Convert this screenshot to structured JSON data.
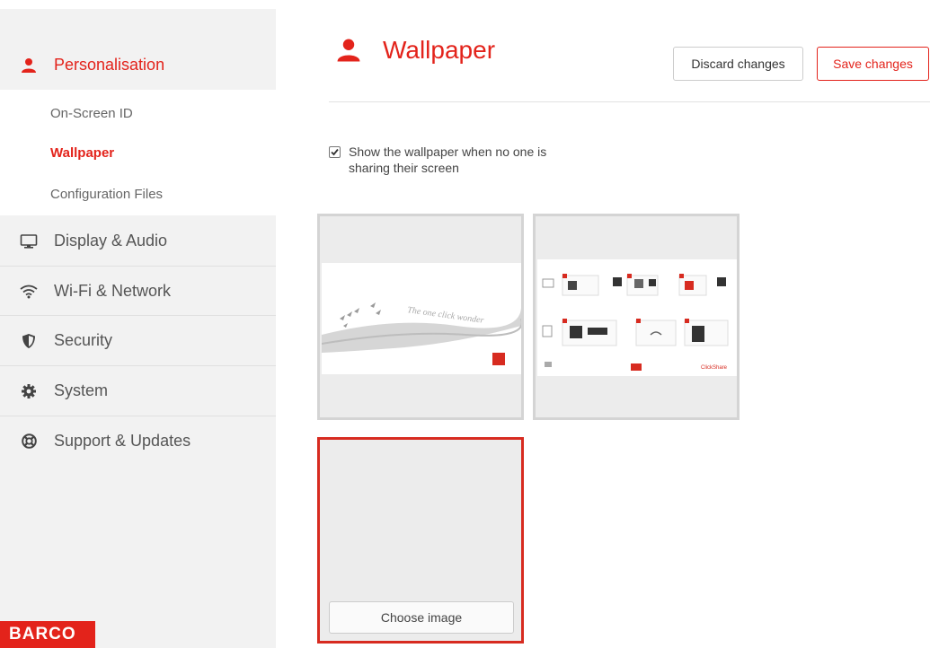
{
  "sidebar": {
    "section_title": "Personalisation",
    "sub_items": [
      {
        "label": "On-Screen ID"
      },
      {
        "label": "Wallpaper"
      },
      {
        "label": "Configuration Files"
      }
    ],
    "items": [
      {
        "label": "Display & Audio",
        "icon": "monitor-icon"
      },
      {
        "label": "Wi-Fi & Network",
        "icon": "wifi-icon"
      },
      {
        "label": "Security",
        "icon": "shield-icon"
      },
      {
        "label": "System",
        "icon": "gear-icon"
      },
      {
        "label": "Support & Updates",
        "icon": "lifebuoy-icon"
      }
    ],
    "logo": "BARCO"
  },
  "main": {
    "title": "Wallpaper",
    "discard_label": "Discard changes",
    "save_label": "Save changes",
    "checkbox_label": "Show the wallpaper when no one is sharing their screen",
    "checkbox_checked": true,
    "tiles": [
      {
        "thumb_text": "The one click wonder"
      },
      {
        "thumb_text": "ClickShare"
      },
      {
        "button_label": "Choose image"
      }
    ]
  },
  "colors": {
    "accent": "#e3231b",
    "sidebar_bg": "#f2f2f2"
  }
}
